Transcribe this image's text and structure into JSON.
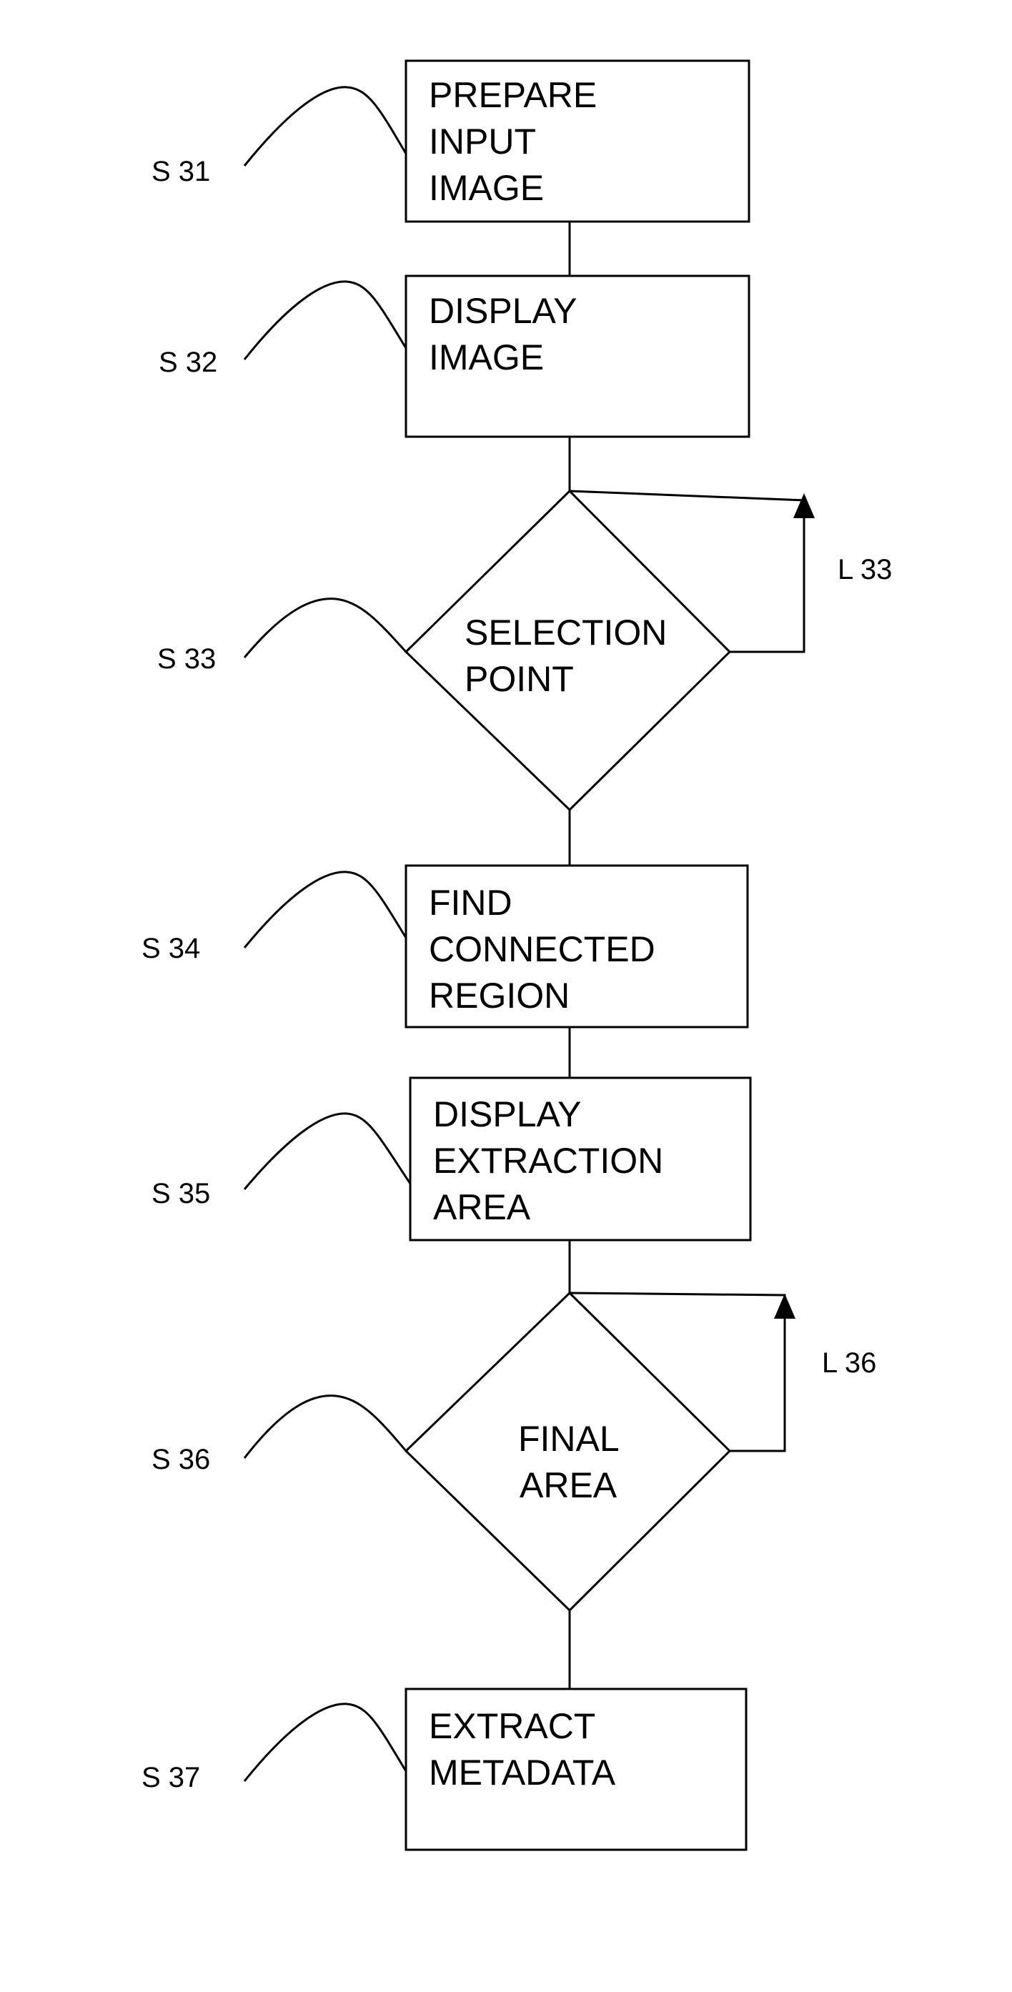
{
  "diagram": {
    "type": "flowchart",
    "steps": [
      {
        "id": "S 31",
        "kind": "process",
        "lines": [
          "PREPARE",
          "INPUT",
          "IMAGE"
        ]
      },
      {
        "id": "S 32",
        "kind": "process",
        "lines": [
          "DISPLAY",
          "IMAGE"
        ]
      },
      {
        "id": "S 33",
        "kind": "decision",
        "lines": [
          "SELECTION",
          "POINT"
        ],
        "loop": "L 33"
      },
      {
        "id": "S 34",
        "kind": "process",
        "lines": [
          "FIND",
          "CONNECTED",
          "REGION"
        ]
      },
      {
        "id": "S 35",
        "kind": "process",
        "lines": [
          "DISPLAY",
          "EXTRACTION",
          "AREA"
        ]
      },
      {
        "id": "S 36",
        "kind": "decision",
        "lines": [
          "FINAL",
          "AREA"
        ],
        "loop": "L 36"
      },
      {
        "id": "S 37",
        "kind": "process",
        "lines": [
          "EXTRACT",
          "METADATA"
        ]
      }
    ],
    "edges": [
      [
        "S 31",
        "S 32"
      ],
      [
        "S 32",
        "S 33"
      ],
      [
        "S 33",
        "S 34"
      ],
      [
        "S 34",
        "S 35"
      ],
      [
        "S 35",
        "S 36"
      ],
      [
        "S 36",
        "S 37"
      ],
      [
        "S 33",
        "S 33"
      ],
      [
        "S 36",
        "S 36"
      ]
    ]
  }
}
